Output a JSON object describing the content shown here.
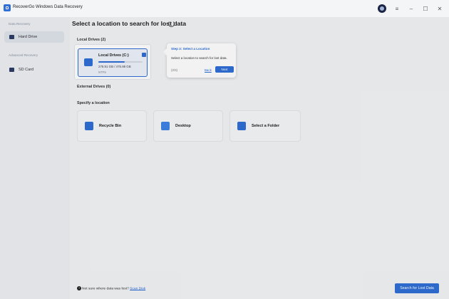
{
  "app": {
    "title": "RecoverGo Windows Data Recovery"
  },
  "window_controls": {
    "menu": "≡",
    "minimize": "–",
    "maximize": "☐",
    "close": "✕"
  },
  "sidebar": {
    "section_data_recovery": "Data Recovery",
    "item_hard_drive": "Hard Drive",
    "section_advanced_recovery": "Advanced Recovery",
    "item_sd_card": "SD Card"
  },
  "main": {
    "title": "Select a location to search for lost data",
    "local_drives_label": "Local Drives (2)",
    "external_drives_label": "External Drives (0)",
    "specify_location_label": "Specify a location",
    "drive": {
      "name": "Local Drives (C:)",
      "size": "278.91 GB / 475.98 GB",
      "filesystem": "NTFS",
      "used_fraction": 0.59
    },
    "locations": [
      {
        "label": "Recycle Bin",
        "icon": "recycle-bin-icon"
      },
      {
        "label": "Desktop",
        "icon": "desktop-icon"
      },
      {
        "label": "Select a Folder",
        "icon": "folder-icon"
      }
    ],
    "help_text": "Not sure where data was lost?",
    "help_link": "Scan Disk",
    "search_button": "Search for Lost Data"
  },
  "popover": {
    "step": "Step 2: Select a Location",
    "text": "Select a location to search for lost data.",
    "count": "(2/3)",
    "back": "Back",
    "next": "Next"
  },
  "colors": {
    "accent": "#2f6fd6",
    "sidebar_bg": "#eef0f4",
    "main_bg": "#f3f4f6"
  }
}
